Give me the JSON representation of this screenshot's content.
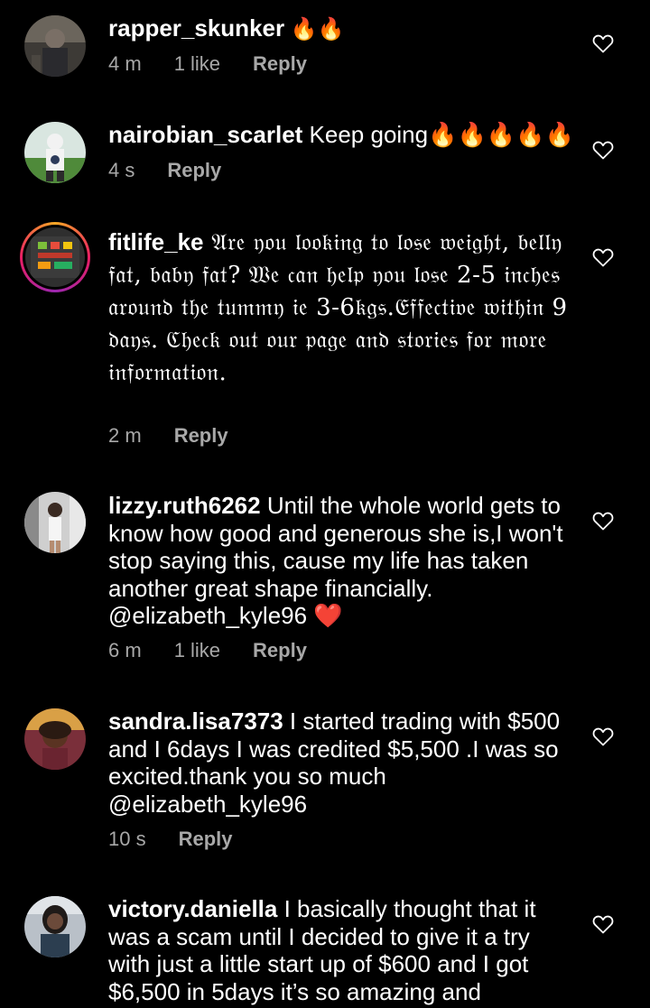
{
  "comments": [
    {
      "username": "rapper_skunker",
      "text": " 🔥🔥",
      "time": "4 m",
      "likes": "1 like",
      "reply": "Reply"
    },
    {
      "username": "nairobian_scarlet",
      "text": " Keep going🔥🔥🔥🔥🔥",
      "time": "4 s",
      "likes": "",
      "reply": "Reply"
    },
    {
      "username": "fitlife_ke",
      "text": " 𝔄𝔯𝔢 𝔶𝔬𝔲 𝔩𝔬𝔬𝔨𝔦𝔫𝔤 𝔱𝔬 𝔩𝔬𝔰𝔢 𝔴𝔢𝔦𝔤𝔥𝔱, 𝔟𝔢𝔩𝔩𝔶 𝔣𝔞𝔱, 𝔟𝔞𝔟𝔶 𝔣𝔞𝔱? 𝔚𝔢 𝔠𝔞𝔫 𝔥𝔢𝔩𝔭 𝔶𝔬𝔲 𝔩𝔬𝔰𝔢 2-5 𝔦𝔫𝔠𝔥𝔢𝔰 𝔞𝔯𝔬𝔲𝔫𝔡 𝔱𝔥𝔢 𝔱𝔲𝔪𝔪𝔶 𝔦𝔢 3-6𝔨𝔤𝔰.𝔈𝔣𝔣𝔢𝔠𝔱𝔦𝔳𝔢 𝔴𝔦𝔱𝔥𝔦𝔫 9 𝔡𝔞𝔶𝔰. ℭ𝔥𝔢𝔠𝔨 𝔬𝔲𝔱 𝔬𝔲𝔯 𝔭𝔞𝔤𝔢 𝔞𝔫𝔡 𝔰𝔱𝔬𝔯𝔦𝔢𝔰 𝔣𝔬𝔯 𝔪𝔬𝔯𝔢 𝔦𝔫𝔣𝔬𝔯𝔪𝔞𝔱𝔦𝔬𝔫.",
      "time": "2 m",
      "likes": "",
      "reply": "Reply"
    },
    {
      "username": "lizzy.ruth6262",
      "text": " Until the whole world gets to know how good and generous she is,I won't stop saying this, cause my life has taken another great shape financially. @elizabeth_kyle96 ❤️",
      "time": "6 m",
      "likes": "1 like",
      "reply": "Reply"
    },
    {
      "username": "sandra.lisa7373",
      "text": " I started trading with $500 and I 6days I was credited $5,500 .I was so excited.thank you so much @elizabeth_kyle96",
      "time": "10 s",
      "likes": "",
      "reply": "Reply"
    },
    {
      "username": "victory.daniella",
      "text": " I basically thought that it was a scam until I decided to give it a try with just a little start up of $600 and I got $6,500 in 5days it’s so amazing and",
      "time": "",
      "likes": "",
      "reply": ""
    }
  ],
  "icons": {
    "like": "heart-outline-icon"
  },
  "colors": {
    "background": "#000000",
    "text": "#ffffff",
    "meta": "#a8a8a8"
  }
}
